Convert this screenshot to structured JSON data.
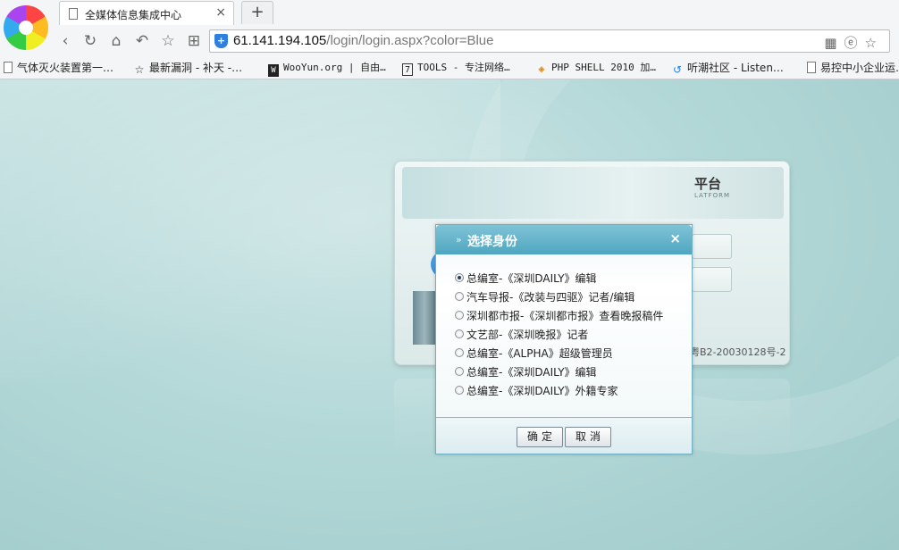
{
  "browser": {
    "tab": {
      "title": "全媒体信息集成中心",
      "close": "×"
    },
    "newtab": "+",
    "nav": {
      "back": "‹",
      "refresh": "↻",
      "home": "⌂",
      "undo": "↶",
      "favorite": "☆",
      "apps": "⊞"
    },
    "url": {
      "host": "61.141.194.105",
      "path": "/login/login.aspx?color=Blue"
    },
    "url_icons": "▦ⓔ☆",
    "bookmarks": [
      {
        "label": "气体灭火装置第一…",
        "icon": "doc"
      },
      {
        "label": "最新漏洞 - 补天 -…",
        "icon": "☆"
      },
      {
        "label": "WooYun.org | 自由…",
        "icon": "W"
      },
      {
        "label": "TOOLS - 专注网络…",
        "icon": "7"
      },
      {
        "label": "PHP SHELL 2010 加…",
        "icon": "◈"
      },
      {
        "label": "听潮社区 - Listen…",
        "icon": "↺"
      },
      {
        "label": "易控中小企业运…",
        "icon": "doc"
      }
    ]
  },
  "login_panel": {
    "title": "平台",
    "subtitle": "LATFORM",
    "footer": "粤B2-20030128号-2"
  },
  "dialog": {
    "title": "选择身份",
    "close": "×",
    "options": [
      {
        "label": "总编室-《深圳DAILY》编辑",
        "checked": true
      },
      {
        "label": "汽车导报-《改装与四驱》记者/编辑",
        "checked": false
      },
      {
        "label": "深圳都市报-《深圳都市报》查看晚报稿件",
        "checked": false
      },
      {
        "label": "文艺部-《深圳晚报》记者",
        "checked": false
      },
      {
        "label": "总编室-《ALPHA》超级管理员",
        "checked": false
      },
      {
        "label": "总编室-《深圳DAILY》编辑",
        "checked": false
      },
      {
        "label": "总编室-《深圳DAILY》外籍专家",
        "checked": false
      }
    ],
    "ok_label": "确定",
    "cancel_label": "取消",
    "colors": {
      "header": "#4fa6c0",
      "border": "#6fb0c4"
    }
  }
}
